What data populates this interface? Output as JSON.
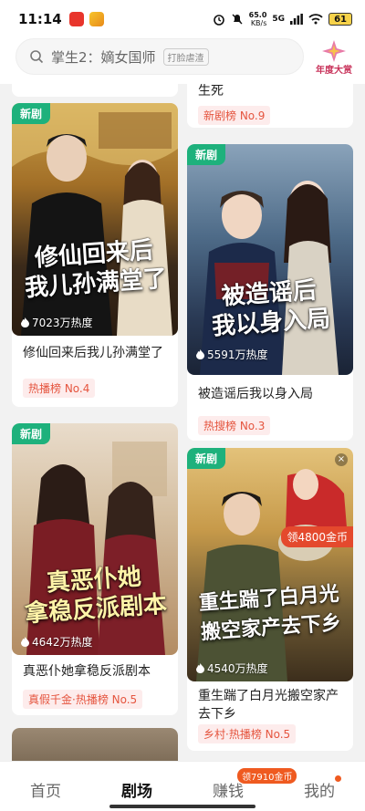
{
  "status_bar": {
    "time": "11:14",
    "net_speed_value": "65.0",
    "net_speed_unit": "KB/s",
    "network": "5G",
    "battery": "61"
  },
  "search": {
    "text": "掌生2：嫡女国师",
    "tag": "打脸虐渣"
  },
  "award": {
    "label": "年度大赏"
  },
  "cards": {
    "top_right": {
      "title_tail": "生死",
      "rank": "新剧榜 No.9"
    },
    "c1": {
      "badge": "新剧",
      "poster_title_line1": "修仙回来后",
      "poster_title_line2": "我儿孙满堂了",
      "heat": "7023万热度",
      "title": "修仙回来后我儿孙满堂了",
      "rank": "热播榜 No.4"
    },
    "c2": {
      "badge": "新剧",
      "poster_title_line1": "被造谣后",
      "poster_title_line2": "我以身入局",
      "heat": "5591万热度",
      "title": "被造谣后我以身入局",
      "rank": "热搜榜 No.3"
    },
    "c3": {
      "badge": "新剧",
      "poster_title_line1": "真恶仆她",
      "poster_title_line2": "拿稳反派剧本",
      "heat": "4642万热度",
      "title": "真恶仆她拿稳反派剧本",
      "rank": "真假千金·热播榜 No.5"
    },
    "c4": {
      "badge": "新剧",
      "poster_title_line1": "重生踹了白月光",
      "poster_title_line2": "搬空家产去下乡",
      "heat": "4540万热度",
      "title": "重生踹了白月光搬空家产去下乡",
      "rank": "乡村·热播榜 No.5",
      "coin_reward": "领4800金币",
      "close": "×"
    }
  },
  "tabs": [
    {
      "label": "首页"
    },
    {
      "label": "剧场"
    },
    {
      "label": "赚钱",
      "badge": "领7910金币"
    },
    {
      "label": "我的"
    }
  ],
  "colors": {
    "accent_green": "#1eb17c",
    "rank_red": "#e5553f",
    "coin_orange": "#ef5a20"
  }
}
